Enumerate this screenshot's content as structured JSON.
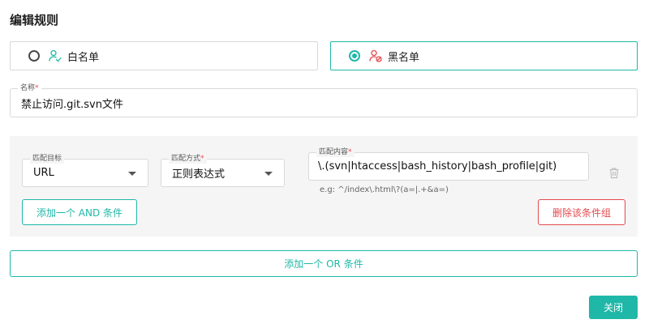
{
  "header": {
    "title": "编辑规则"
  },
  "mode": {
    "options": [
      {
        "label": "白名单",
        "icon": "user-check-icon",
        "selected": false
      },
      {
        "label": "黑名单",
        "icon": "user-block-icon",
        "selected": true
      }
    ]
  },
  "name_field": {
    "label": "名称",
    "required_mark": "*",
    "value": "禁止访问.git.svn文件"
  },
  "condition_group": {
    "target": {
      "label": "匹配目标",
      "value": "URL"
    },
    "method": {
      "label": "匹配方式",
      "required_mark": "*",
      "value": "正则表达式"
    },
    "content": {
      "label": "匹配内容",
      "required_mark": "*",
      "value": "\\.(svn|htaccess|bash_history|bash_profile|git)"
    },
    "hint": "e.g: ^/index\\.html\\?(a=|.+&a=)",
    "delete_icon": "trash-icon",
    "add_and_label": "添加一个 AND 条件",
    "delete_group_label": "删除该条件组"
  },
  "add_or_label": "添加一个 OR 条件",
  "close_label": "关闭",
  "colors": {
    "accent": "#1fb8a8",
    "danger": "#e5484d",
    "group_bg": "#f5f5f5"
  }
}
